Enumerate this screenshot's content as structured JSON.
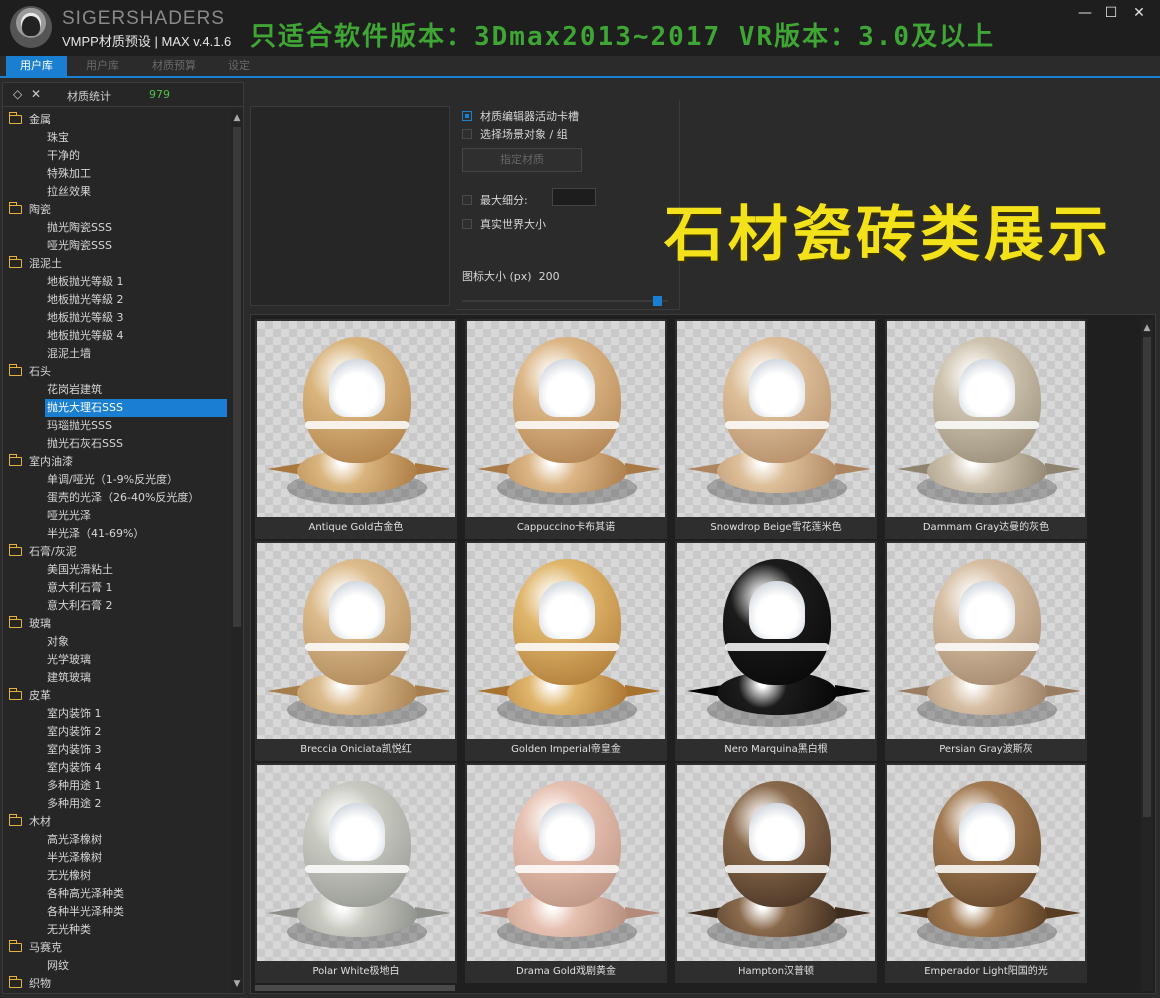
{
  "header": {
    "brand": "SIGERSHADERS",
    "version": "VMPP材质预设 | MAX v.4.1.6",
    "banner": "只适合软件版本：3Dmax2013~2017  VR版本：3.0及以上",
    "window": {
      "minimize": "—",
      "maximize": "☐",
      "close": "✕"
    }
  },
  "tabs": [
    {
      "label": "用户库",
      "active": true
    },
    {
      "label": "用户库",
      "active": false
    },
    {
      "label": "材质预算",
      "active": false
    },
    {
      "label": "设定",
      "active": false
    }
  ],
  "left": {
    "expand_icon": "◇",
    "collapse_icon": "✕",
    "stat_label": "材质统计",
    "stat_count": "979",
    "tree": [
      {
        "type": "cat",
        "label": "金属"
      },
      {
        "type": "sub",
        "label": "珠宝"
      },
      {
        "type": "sub",
        "label": "干净的"
      },
      {
        "type": "sub",
        "label": "特殊加工"
      },
      {
        "type": "sub",
        "label": "拉丝效果"
      },
      {
        "type": "cat",
        "label": "陶瓷"
      },
      {
        "type": "sub",
        "label": "抛光陶瓷SSS"
      },
      {
        "type": "sub",
        "label": "哑光陶瓷SSS"
      },
      {
        "type": "cat",
        "label": "混泥土"
      },
      {
        "type": "sub",
        "label": "地板抛光等級 1"
      },
      {
        "type": "sub",
        "label": "地板抛光等級 2"
      },
      {
        "type": "sub",
        "label": "地板抛光等級 3"
      },
      {
        "type": "sub",
        "label": "地板抛光等級 4"
      },
      {
        "type": "sub",
        "label": "混泥土墙"
      },
      {
        "type": "cat",
        "label": "石头"
      },
      {
        "type": "sub",
        "label": "花岗岩建筑"
      },
      {
        "type": "sel",
        "label": "抛光大理石SSS"
      },
      {
        "type": "sub",
        "label": "玛瑙抛光SSS"
      },
      {
        "type": "sub",
        "label": "抛光石灰石SSS"
      },
      {
        "type": "cat",
        "label": "室内油漆"
      },
      {
        "type": "sub",
        "label": "单调/哑光（1-9%反光度）"
      },
      {
        "type": "sub",
        "label": "蛋壳的光泽（26-40%反光度）"
      },
      {
        "type": "sub",
        "label": "哑光光泽"
      },
      {
        "type": "sub",
        "label": "半光泽（41-69%）"
      },
      {
        "type": "cat",
        "label": "石膏/灰泥"
      },
      {
        "type": "sub",
        "label": "美国光滑粘土"
      },
      {
        "type": "sub",
        "label": "意大利石膏 1"
      },
      {
        "type": "sub",
        "label": "意大利石膏 2"
      },
      {
        "type": "cat",
        "label": "玻璃"
      },
      {
        "type": "sub",
        "label": "对象"
      },
      {
        "type": "sub",
        "label": "光学玻璃"
      },
      {
        "type": "sub",
        "label": "建筑玻璃"
      },
      {
        "type": "cat",
        "label": "皮革"
      },
      {
        "type": "sub",
        "label": "室内装饰 1"
      },
      {
        "type": "sub",
        "label": "室内装饰 2"
      },
      {
        "type": "sub",
        "label": "室内装饰 3"
      },
      {
        "type": "sub",
        "label": "室内装饰 4"
      },
      {
        "type": "sub",
        "label": "多种用途 1"
      },
      {
        "type": "sub",
        "label": "多种用途 2"
      },
      {
        "type": "cat",
        "label": "木材"
      },
      {
        "type": "sub",
        "label": "高光泽橡树"
      },
      {
        "type": "sub",
        "label": "半光泽橡树"
      },
      {
        "type": "sub",
        "label": "无光橡树"
      },
      {
        "type": "sub",
        "label": "各种高光泽种类"
      },
      {
        "type": "sub",
        "label": "各种半光泽种类"
      },
      {
        "type": "sub",
        "label": "无光种类"
      },
      {
        "type": "cat",
        "label": "马赛克"
      },
      {
        "type": "sub",
        "label": "网纹"
      },
      {
        "type": "cat",
        "label": "织物"
      }
    ]
  },
  "options": {
    "editor_slot": "材质编辑器活动卡槽",
    "select_scene": "选择场景对象 / 组",
    "assign_button": "指定材质",
    "max_subdiv": "最大细分:",
    "real_world": "真实世界大小",
    "icon_size_label": "图标大小 (px)",
    "icon_size_value": "200",
    "icon_size_fraction": 0.97
  },
  "headline": "石材瓷砖类展示",
  "materials": [
    {
      "name": "Antique Gold古金色",
      "color": "#d9b57e",
      "dark": "#a97840"
    },
    {
      "name": "Cappuccino卡布其诺",
      "color": "#dcb686",
      "dark": "#a97a47"
    },
    {
      "name": "Snowdrop Beige雪花莲米色",
      "color": "#ddbf9a",
      "dark": "#ad8560"
    },
    {
      "name": "Dammam Gray达曼的灰色",
      "color": "#cfc4b0",
      "dark": "#8f8470"
    },
    {
      "name": "Breccia Oniciata凯悦红",
      "color": "#dcbb8c",
      "dark": "#a67e4d"
    },
    {
      "name": "Golden Imperial帝皇金",
      "color": "#e0b66c",
      "dark": "#a8722f"
    },
    {
      "name": "Nero Marquina黑白根",
      "color": "#1b1b1b",
      "dark": "#050505"
    },
    {
      "name": "Persian Gray波斯灰",
      "color": "#d6bfa4",
      "dark": "#9a7e63"
    },
    {
      "name": "Polar White极地白",
      "color": "#c9cbc2",
      "dark": "#8d908a"
    },
    {
      "name": "Drama Gold戏剧黄金",
      "color": "#e6c0b0",
      "dark": "#b58c7c"
    },
    {
      "name": "Hampton汉普顿",
      "color": "#8a6a4c",
      "dark": "#3e2c1e"
    },
    {
      "name": "Emperador Light阳国的光",
      "color": "#a27a52",
      "dark": "#5a3e24"
    }
  ]
}
